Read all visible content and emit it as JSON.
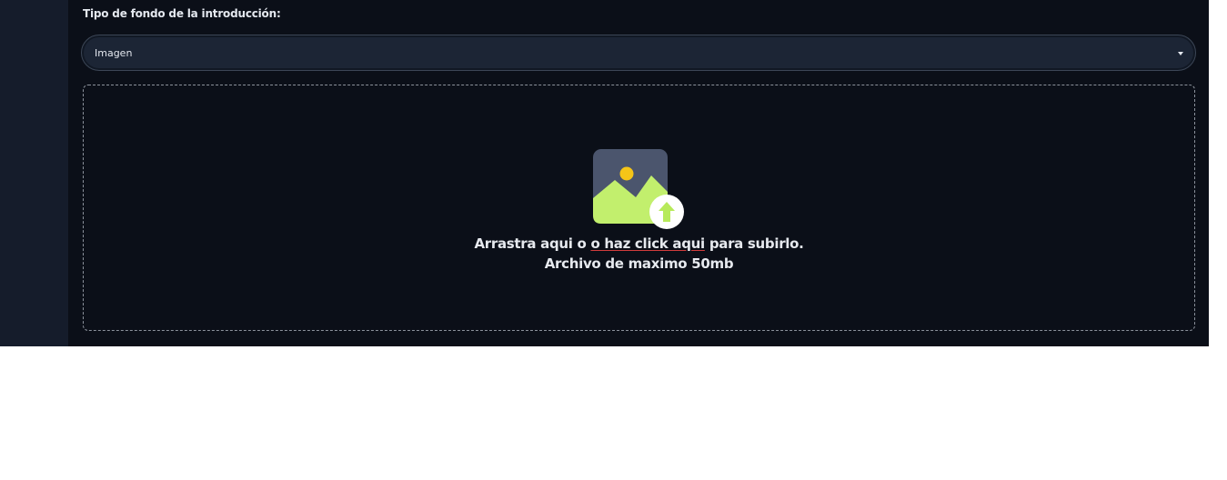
{
  "form": {
    "label": "Tipo de fondo de la introducción:",
    "select": {
      "value": "Imagen"
    }
  },
  "dropzone": {
    "text_before": "Arrastra aqui o ",
    "link_text": "o haz click aqui",
    "text_after": " para subirlo.",
    "max_size": "Archivo de maximo 50mb"
  },
  "colors": {
    "sidebar_bg": "#151c2b",
    "main_bg": "#0b0f18",
    "select_bg": "#1c2535",
    "image_icon_bg": "#4b556d",
    "image_icon_mountain": "#c2ef6d",
    "image_icon_sun": "#f5c518",
    "upload_arrow": "#b7ea5a"
  },
  "icons": [
    "image-upload-icon",
    "chevron-down-icon"
  ]
}
